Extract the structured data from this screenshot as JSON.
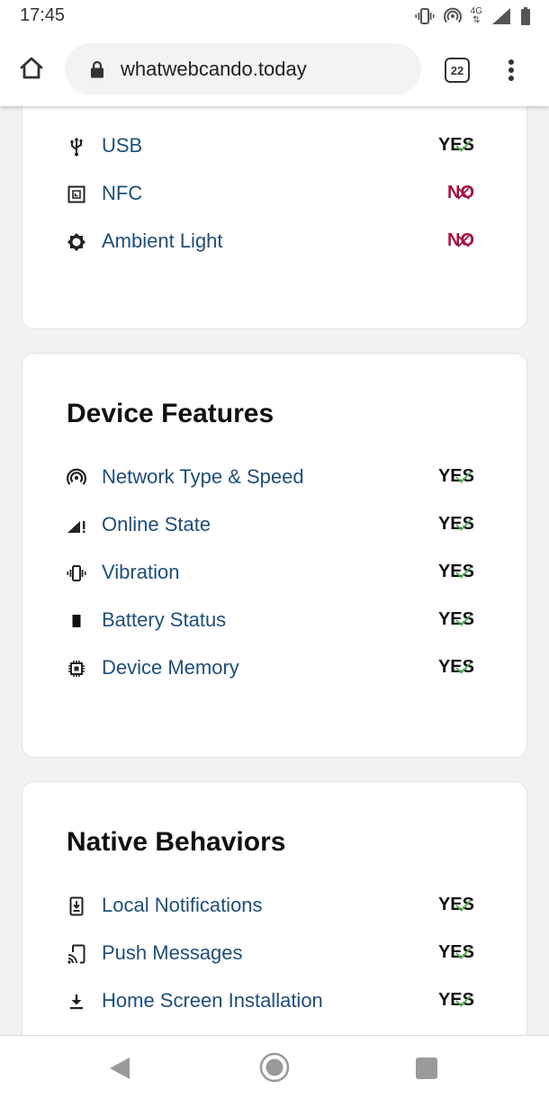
{
  "status_bar": {
    "time": "17:45",
    "network_label_top": "4G",
    "icons": [
      "vibrate-icon",
      "hotspot-icon",
      "network-4g-icon",
      "signal-icon",
      "battery-icon"
    ]
  },
  "browser": {
    "url": "whatwebcando.today",
    "tab_count": "22",
    "icons": [
      "home-icon",
      "lock-icon",
      "tabs-icon",
      "more-vert-icon"
    ]
  },
  "colors": {
    "link": "#1f4e79",
    "no": "#a4123f",
    "check": "#4caf50",
    "title": "#111111"
  },
  "cards": [
    {
      "title": "",
      "rows": [
        {
          "label": "USB",
          "status": "YES",
          "icon": "usb-icon"
        },
        {
          "label": "NFC",
          "status": "NO",
          "icon": "nfc-icon"
        },
        {
          "label": "Ambient Light",
          "status": "NO",
          "icon": "brightness-icon"
        }
      ]
    },
    {
      "title": "Device Features",
      "rows": [
        {
          "label": "Network Type & Speed",
          "status": "YES",
          "icon": "hotspot-icon"
        },
        {
          "label": "Online State",
          "status": "YES",
          "icon": "signal-alert-icon"
        },
        {
          "label": "Vibration",
          "status": "YES",
          "icon": "vibration-icon"
        },
        {
          "label": "Battery Status",
          "status": "YES",
          "icon": "battery-icon"
        },
        {
          "label": "Device Memory",
          "status": "YES",
          "icon": "memory-chip-icon"
        }
      ]
    },
    {
      "title": "Native Behaviors",
      "rows": [
        {
          "label": "Local Notifications",
          "status": "YES",
          "icon": "notification-phone-icon"
        },
        {
          "label": "Push Messages",
          "status": "YES",
          "icon": "cast-phone-icon"
        },
        {
          "label": "Home Screen Installation",
          "status": "YES",
          "icon": "download-icon"
        }
      ]
    }
  ],
  "nav_bar": {
    "icons": [
      "back-icon",
      "home-circle-icon",
      "recents-icon"
    ]
  }
}
